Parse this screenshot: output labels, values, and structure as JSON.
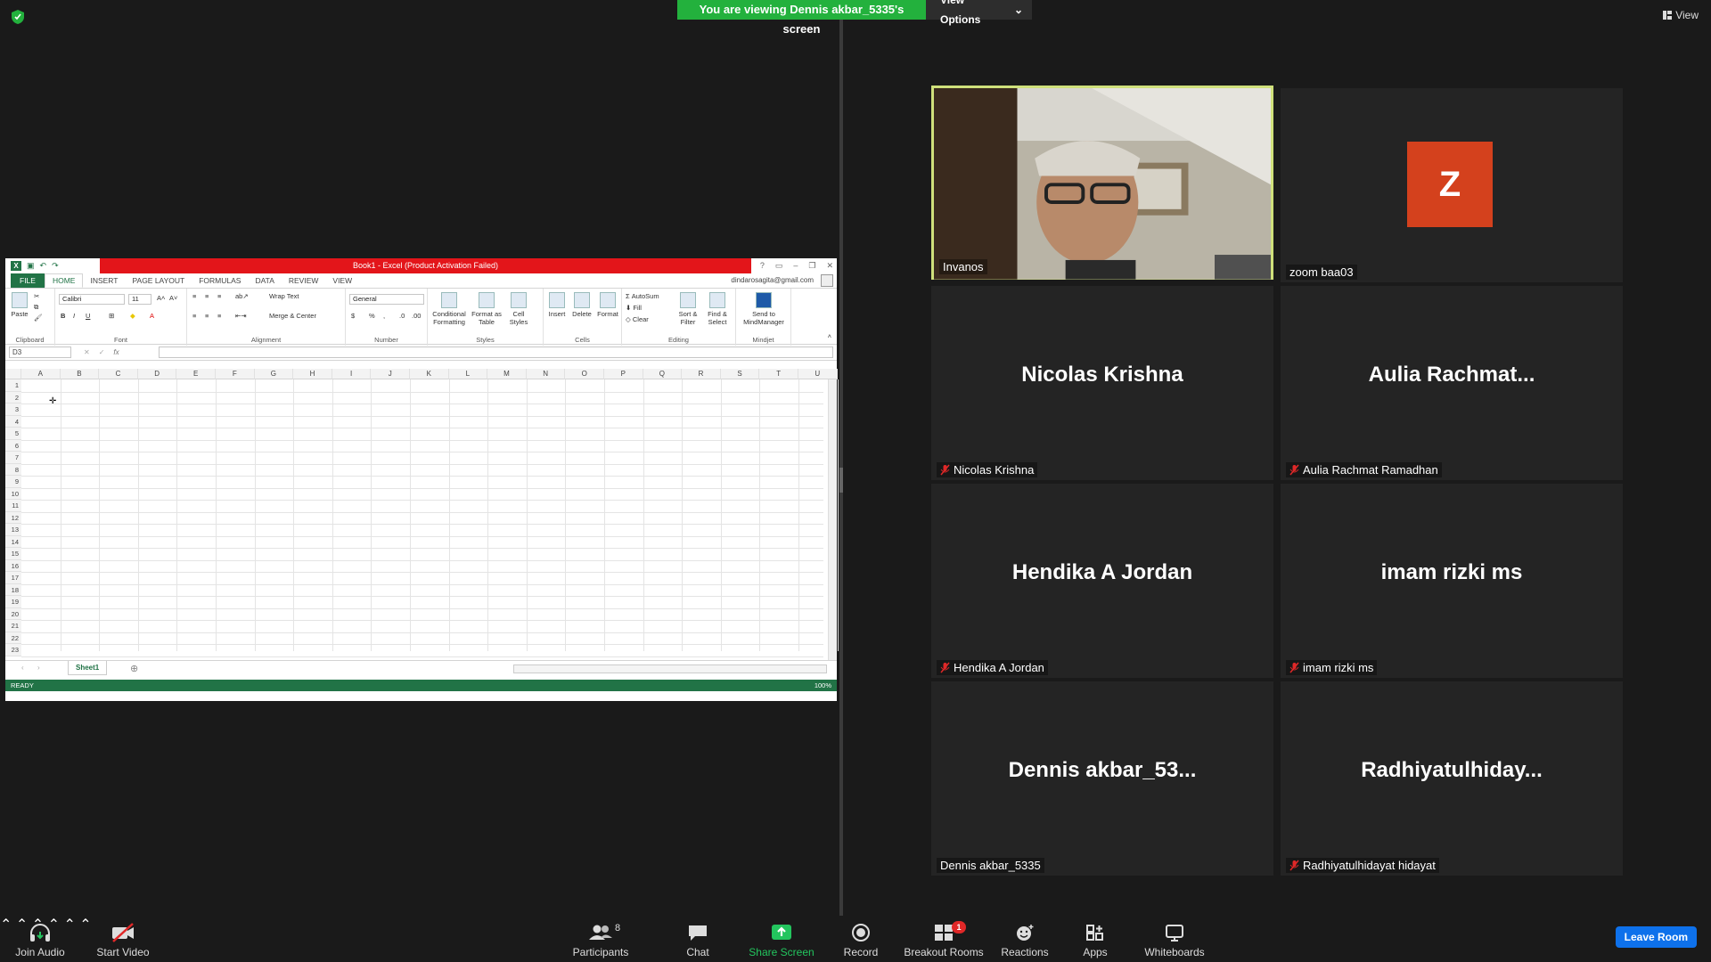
{
  "banner": {
    "text": "You are viewing Dennis akbar_5335's screen",
    "view_options": "View Options"
  },
  "view_label": "View",
  "excel": {
    "title": "Book1 - Excel (Product Activation Failed)",
    "tabs": [
      "FILE",
      "HOME",
      "INSERT",
      "PAGE LAYOUT",
      "FORMULAS",
      "DATA",
      "REVIEW",
      "VIEW"
    ],
    "active_tab": "HOME",
    "user": "dindarosagita@gmail.com",
    "ribbon": {
      "paste": "Paste",
      "font_name": "Calibri",
      "font_size": "11",
      "wrap_text": "Wrap Text",
      "merge_center": "Merge & Center",
      "number_format": "General",
      "conditional_formatting": "Conditional Formatting",
      "format_as_table": "Format as Table",
      "cell_styles": "Cell Styles",
      "insert": "Insert",
      "delete": "Delete",
      "format": "Format",
      "autosum": "AutoSum",
      "fill": "Fill",
      "clear": "Clear",
      "sort_filter": "Sort & Filter",
      "find_select": "Find & Select",
      "send_mindmanager": "Send to MindManager",
      "groups": [
        "Clipboard",
        "Font",
        "Alignment",
        "Number",
        "Styles",
        "Cells",
        "Editing",
        "Mindjet"
      ]
    },
    "name_box": "D3",
    "fx": "fx",
    "columns": [
      "A",
      "B",
      "C",
      "D",
      "E",
      "F",
      "G",
      "H",
      "I",
      "J",
      "K",
      "L",
      "M",
      "N",
      "O",
      "P",
      "Q",
      "R",
      "S",
      "T",
      "U"
    ],
    "rows": [
      "1",
      "2",
      "3",
      "4",
      "5",
      "6",
      "7",
      "8",
      "9",
      "10",
      "11",
      "12",
      "13",
      "14",
      "15",
      "16",
      "17",
      "18",
      "19",
      "20",
      "21",
      "22",
      "23"
    ],
    "sheet": "Sheet1",
    "status": "READY",
    "zoom": "100%"
  },
  "participants": [
    {
      "tile_name": "",
      "label": "Invanos",
      "muted": false,
      "video": true,
      "speaking": true
    },
    {
      "tile_name": "",
      "label": "zoom baa03",
      "muted": false,
      "avatar_letter": "Z"
    },
    {
      "tile_name": "Nicolas Krishna",
      "label": "Nicolas Krishna",
      "muted": true
    },
    {
      "tile_name": "Aulia  Rachmat...",
      "label": "Aulia Rachmat Ramadhan",
      "muted": true
    },
    {
      "tile_name": "Hendika A Jordan",
      "label": "Hendika A Jordan",
      "muted": true
    },
    {
      "tile_name": "imam rizki ms",
      "label": "imam rizki ms",
      "muted": true
    },
    {
      "tile_name": "Dennis  akbar_53...",
      "label": "Dennis akbar_5335",
      "muted": false
    },
    {
      "tile_name": "Radhiyatulhiday...",
      "label": "Radhiyatulhidayat hidayat",
      "muted": true
    }
  ],
  "toolbar": {
    "join_audio": "Join Audio",
    "start_video": "Start Video",
    "participants": "Participants",
    "participants_count": "8",
    "chat": "Chat",
    "share_screen": "Share Screen",
    "record": "Record",
    "breakout_rooms": "Breakout Rooms",
    "breakout_badge": "1",
    "reactions": "Reactions",
    "apps": "Apps",
    "whiteboards": "Whiteboards",
    "leave_room": "Leave Room"
  },
  "colors": {
    "banner_green": "#23b13d",
    "speaking_border": "#cfe07b",
    "avatar_orange": "#d4411d",
    "excel_green": "#217346",
    "excel_title_red": "#e3151a",
    "leave_blue": "#0e71eb",
    "share_green": "#23c55e"
  }
}
